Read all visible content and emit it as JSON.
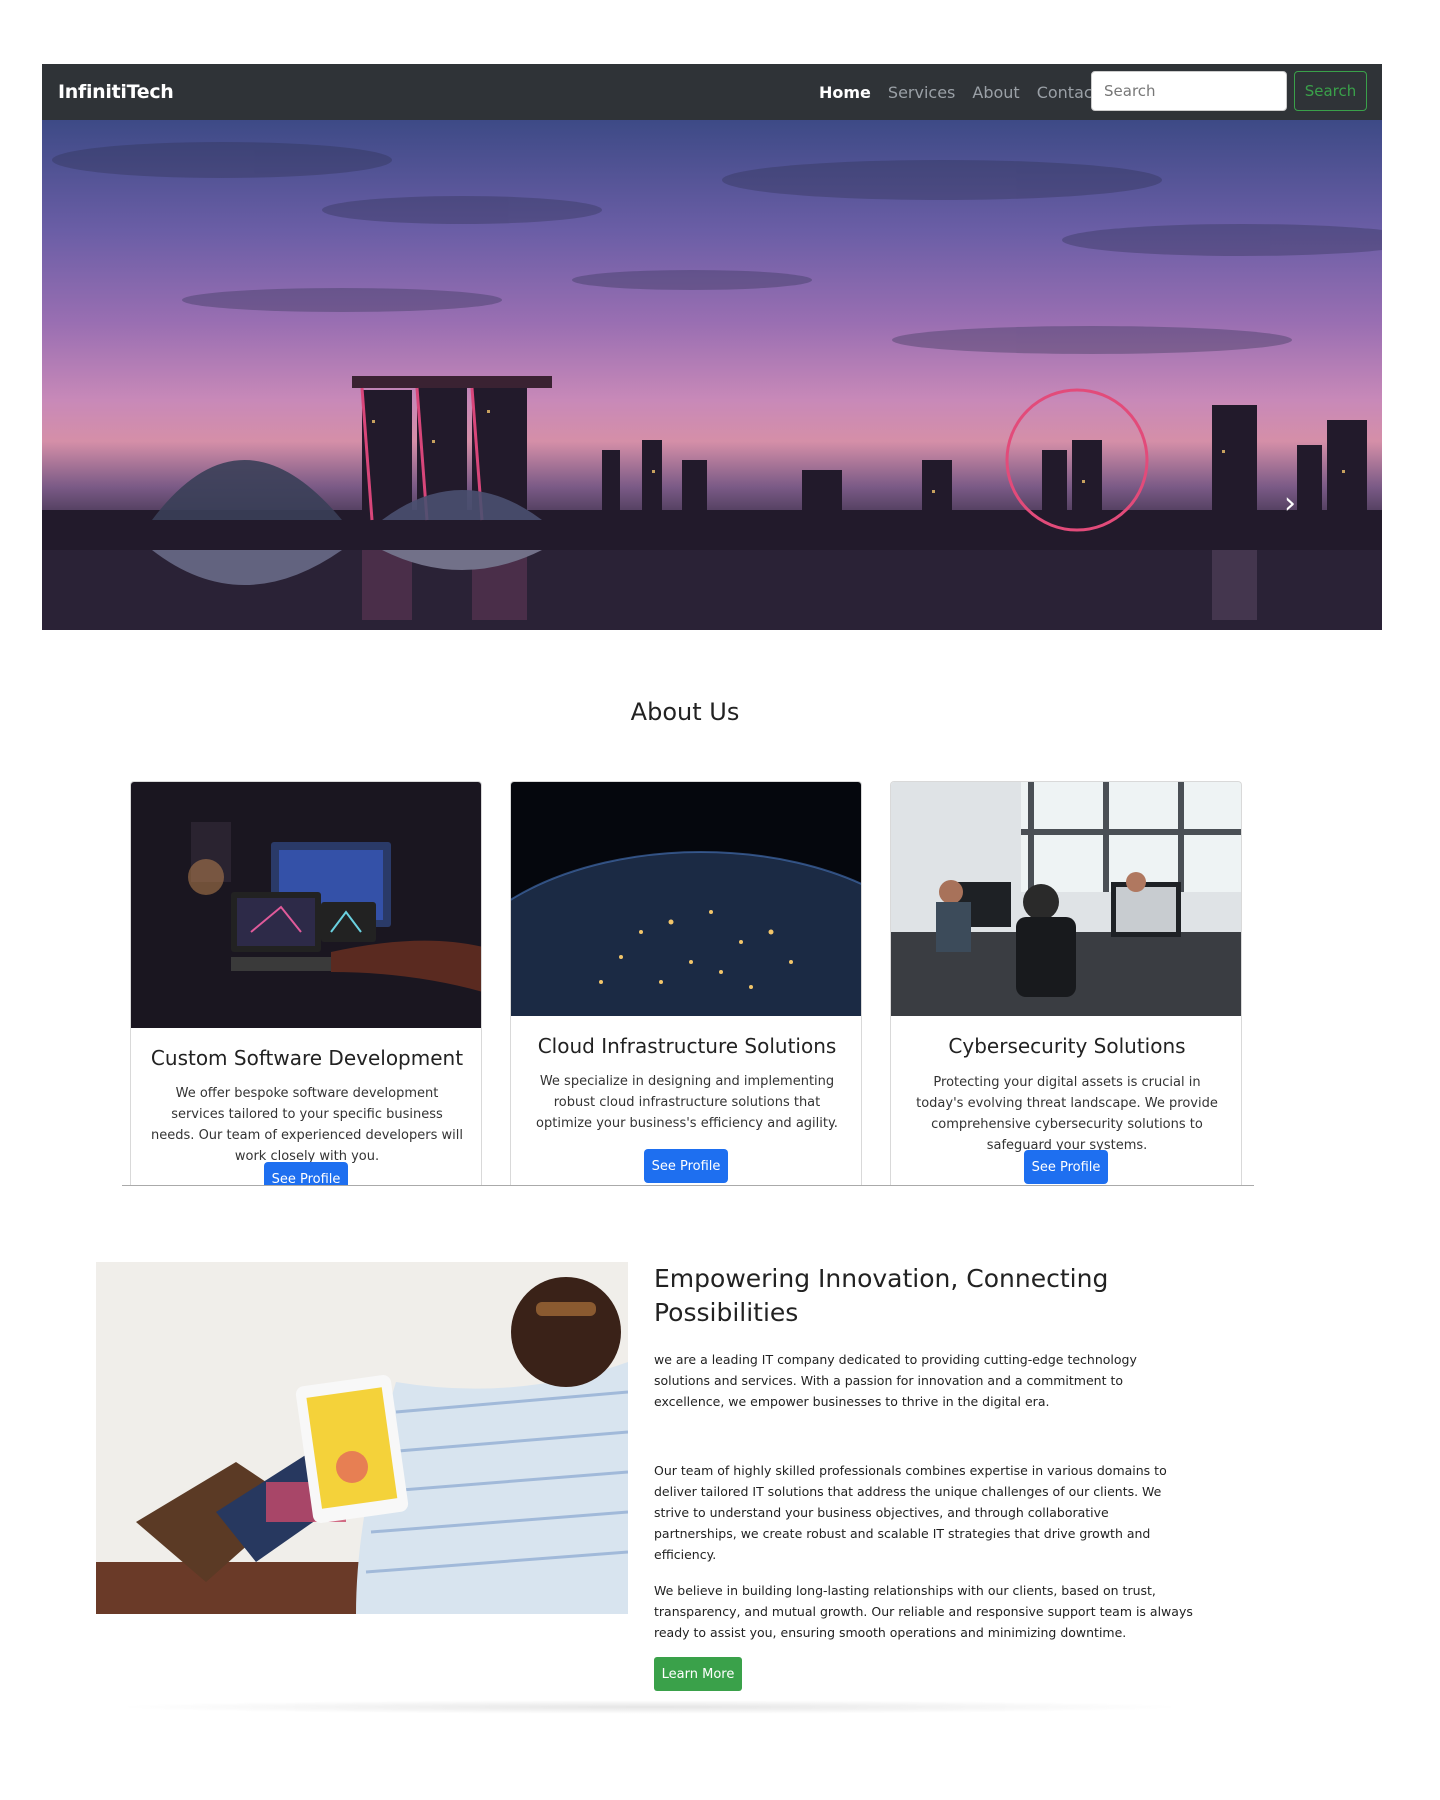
{
  "navbar": {
    "brand": "InfinitiTech",
    "links": [
      "Home",
      "Services",
      "About",
      "Contact"
    ],
    "search_placeholder": "Search",
    "search_button": "Search"
  },
  "hero": {
    "next_icon": "chevron-right-icon"
  },
  "about": {
    "title": "About Us",
    "cards": [
      {
        "title": "Custom Software Development",
        "text": "We offer bespoke software development services tailored to your specific business needs. Our team of experienced developers will work closely with you.",
        "button": "See Profile"
      },
      {
        "title": "Cloud Infrastructure Solutions",
        "text": "We specialize in designing and implementing robust cloud infrastructure solutions that optimize your business's efficiency and agility.",
        "button": "See Profile"
      },
      {
        "title": "Cybersecurity Solutions",
        "text": "Protecting your digital assets is crucial in today's evolving threat landscape. We provide comprehensive cybersecurity solutions to safeguard your systems.",
        "button": "See Profile"
      }
    ]
  },
  "empower": {
    "title": "Empowering Innovation, Connecting Possibilities",
    "paragraphs": [
      "we are a leading IT company dedicated to providing cutting-edge technology solutions and services. With a passion for innovation and a commitment to excellence, we empower businesses to thrive in the digital era.",
      "Our team of highly skilled professionals combines expertise in various domains to deliver tailored IT solutions that address the unique challenges of our clients. We strive to understand your business objectives, and through collaborative partnerships, we create robust and scalable IT strategies that drive growth and efficiency.",
      "We believe in building long-lasting relationships with our clients, based on trust, transparency, and mutual growth. Our reliable and responsive support team is always ready to assist you, ensuring smooth operations and minimizing downtime."
    ],
    "button": "Learn More"
  },
  "colors": {
    "navbar_bg": "#2f3337",
    "primary_button": "#1e6ff0",
    "success_button": "#3aa14a"
  }
}
